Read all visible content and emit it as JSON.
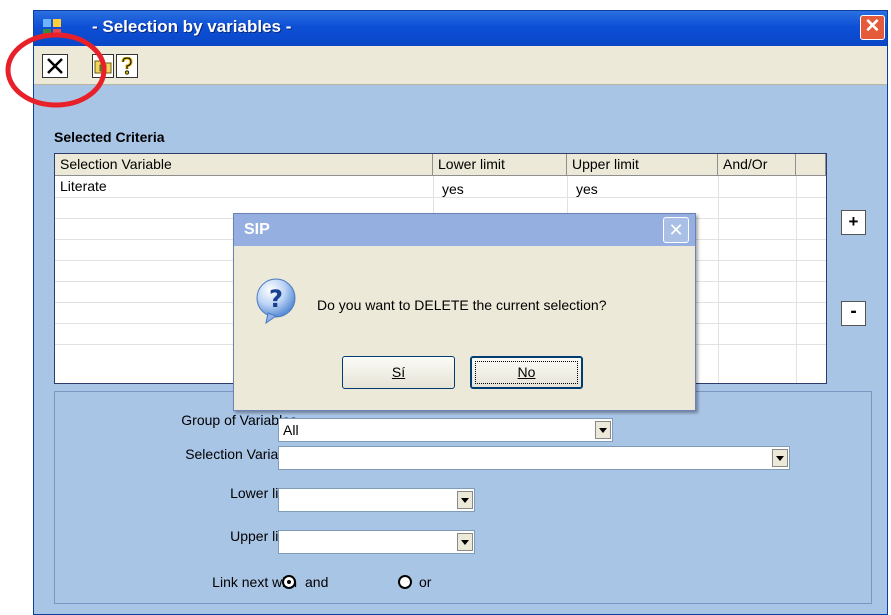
{
  "window": {
    "title": "- Selection by variables -",
    "close_label": "✕"
  },
  "toolbar": {
    "items": [
      {
        "name": "delete-button",
        "icon": "x-icon"
      },
      {
        "name": "open-button",
        "icon": "folder-icon"
      },
      {
        "name": "help-button",
        "icon": "question-icon"
      }
    ]
  },
  "criteria": {
    "label": "Selected Criteria",
    "columns": [
      "Selection Variable",
      "Lower limit",
      "Upper limit",
      "And/Or"
    ],
    "rows": [
      {
        "variable": "Literate",
        "lower": "yes",
        "upper": "yes",
        "andor": ""
      }
    ],
    "add_label": "+",
    "remove_label": "-"
  },
  "form": {
    "group_label": "Group of Variables",
    "group_value": "All",
    "selection_label": "Selection Variable",
    "selection_value": "",
    "lower_label": "Lower limit",
    "lower_value": "",
    "upper_label": "Upper limit",
    "upper_value": "",
    "link_label": "Link next with",
    "link_and": "and",
    "link_or": "or",
    "link_selected": "and"
  },
  "dialog": {
    "title": "SIP",
    "close_label": "✕",
    "message": "Do you want to DELETE the current selection?",
    "yes_label": "Sí",
    "no_label": "No"
  },
  "colors": {
    "titlebar": "#0d4fd6",
    "window_bg": "#a9c5e6",
    "annotation": "#e8202a"
  }
}
